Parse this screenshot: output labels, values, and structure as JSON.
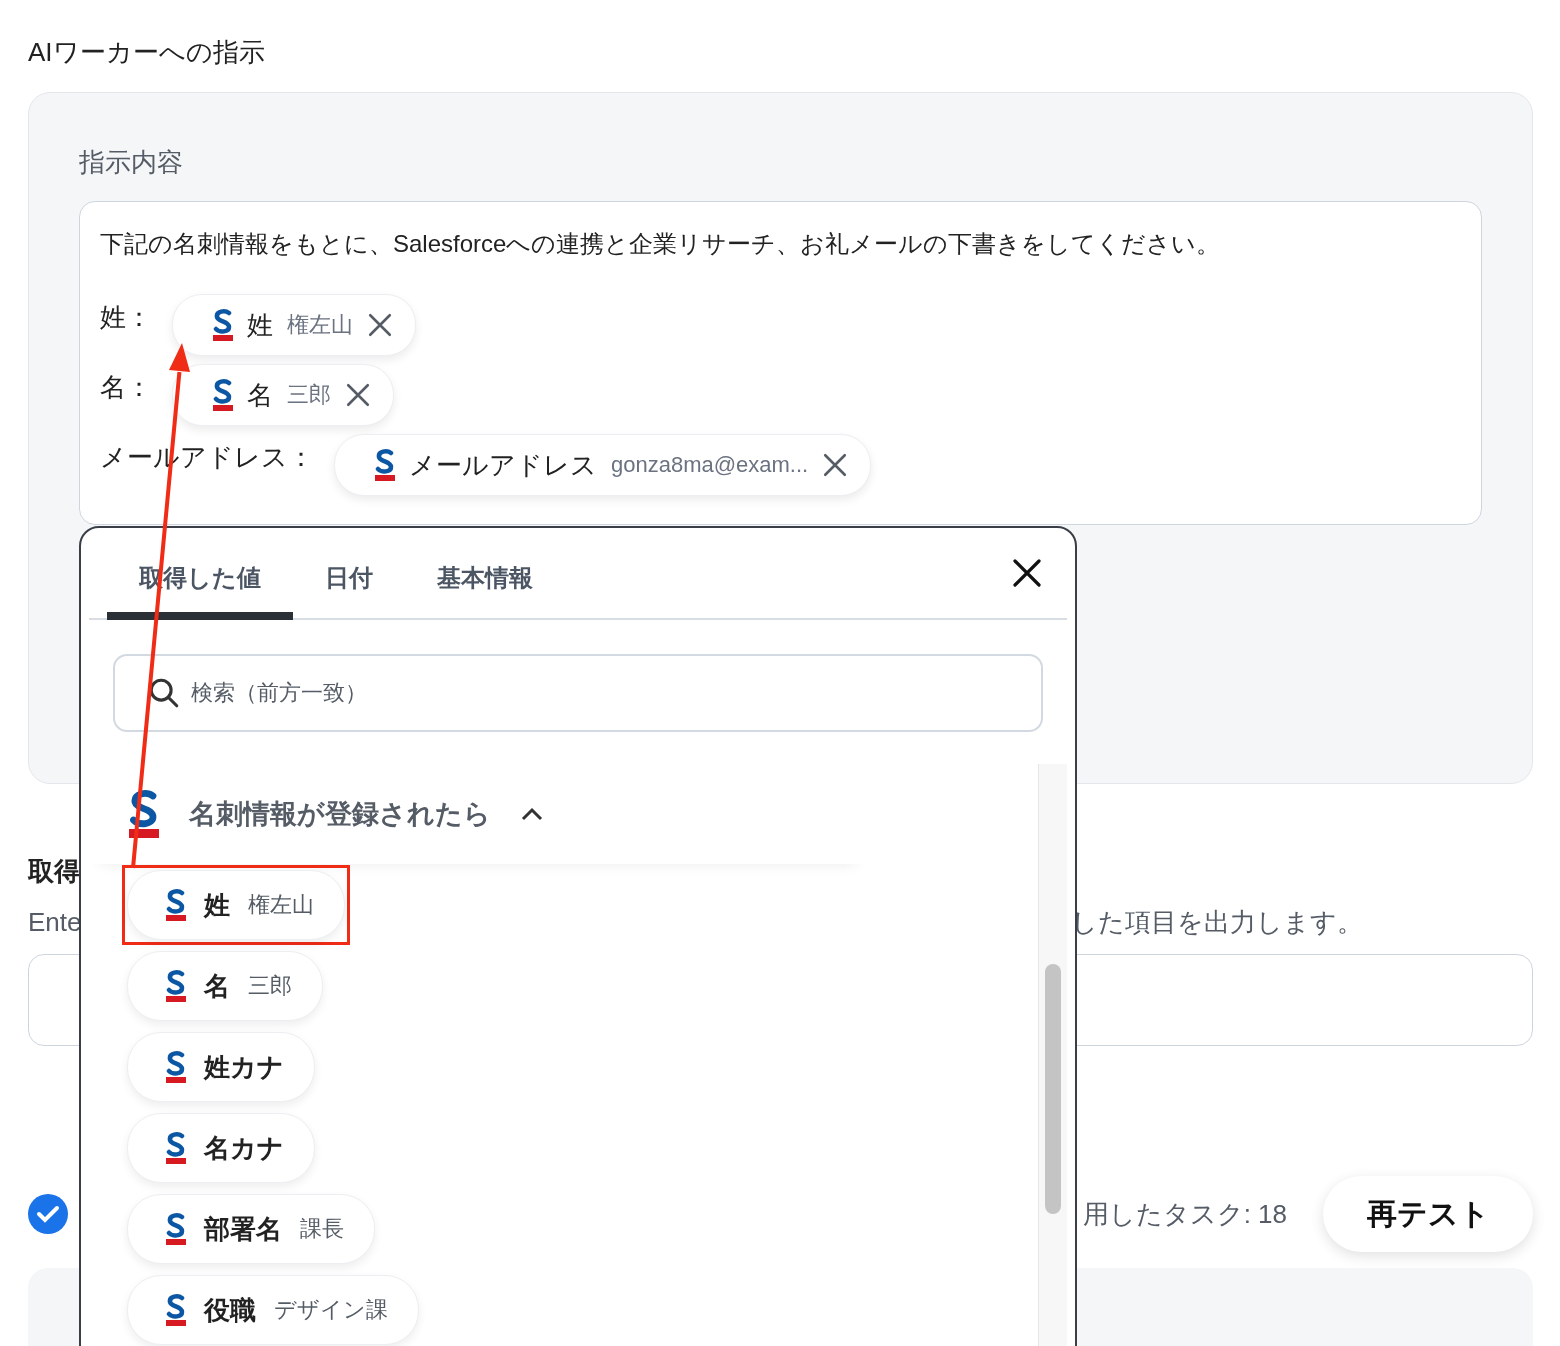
{
  "section_title": "AIワーカーへの指示",
  "instruction": {
    "label": "指示内容",
    "intro": "下記の名刺情報をもとに、Salesforceへの連携と企業リサーチ、お礼メールの下書きをしてください。",
    "fields": [
      {
        "label": "姓：",
        "chip_label": "姓",
        "chip_value": "権左山"
      },
      {
        "label": "名：",
        "chip_label": "名",
        "chip_value": "三郎"
      },
      {
        "label": "メールアドレス：",
        "chip_label": "メールアドレス",
        "chip_value": "gonza8ma@exam..."
      }
    ]
  },
  "output": {
    "heading": "取得",
    "description_left": "Ente",
    "description_right": "した項目を出力します。"
  },
  "status": {
    "done": true,
    "tasks_text": "用したタスク: 18",
    "retest_button": "再テスト"
  },
  "picker": {
    "tabs": [
      {
        "label": "取得した値",
        "selected": true
      },
      {
        "label": "日付",
        "selected": false
      },
      {
        "label": "基本情報",
        "selected": false
      }
    ],
    "search_placeholder": "検索（前方一致）",
    "group": {
      "title": "名刺情報が登録されたら",
      "expanded": true,
      "items": [
        {
          "label": "姓",
          "value": "権左山",
          "highlighted": true
        },
        {
          "label": "名",
          "value": "三郎",
          "highlighted": false
        },
        {
          "label": "姓カナ",
          "highlighted": false
        },
        {
          "label": "名カナ",
          "highlighted": false
        },
        {
          "label": "部署名",
          "value": "課長",
          "highlighted": false
        },
        {
          "label": "役職",
          "value": "デザイン課",
          "highlighted": false
        }
      ]
    }
  }
}
